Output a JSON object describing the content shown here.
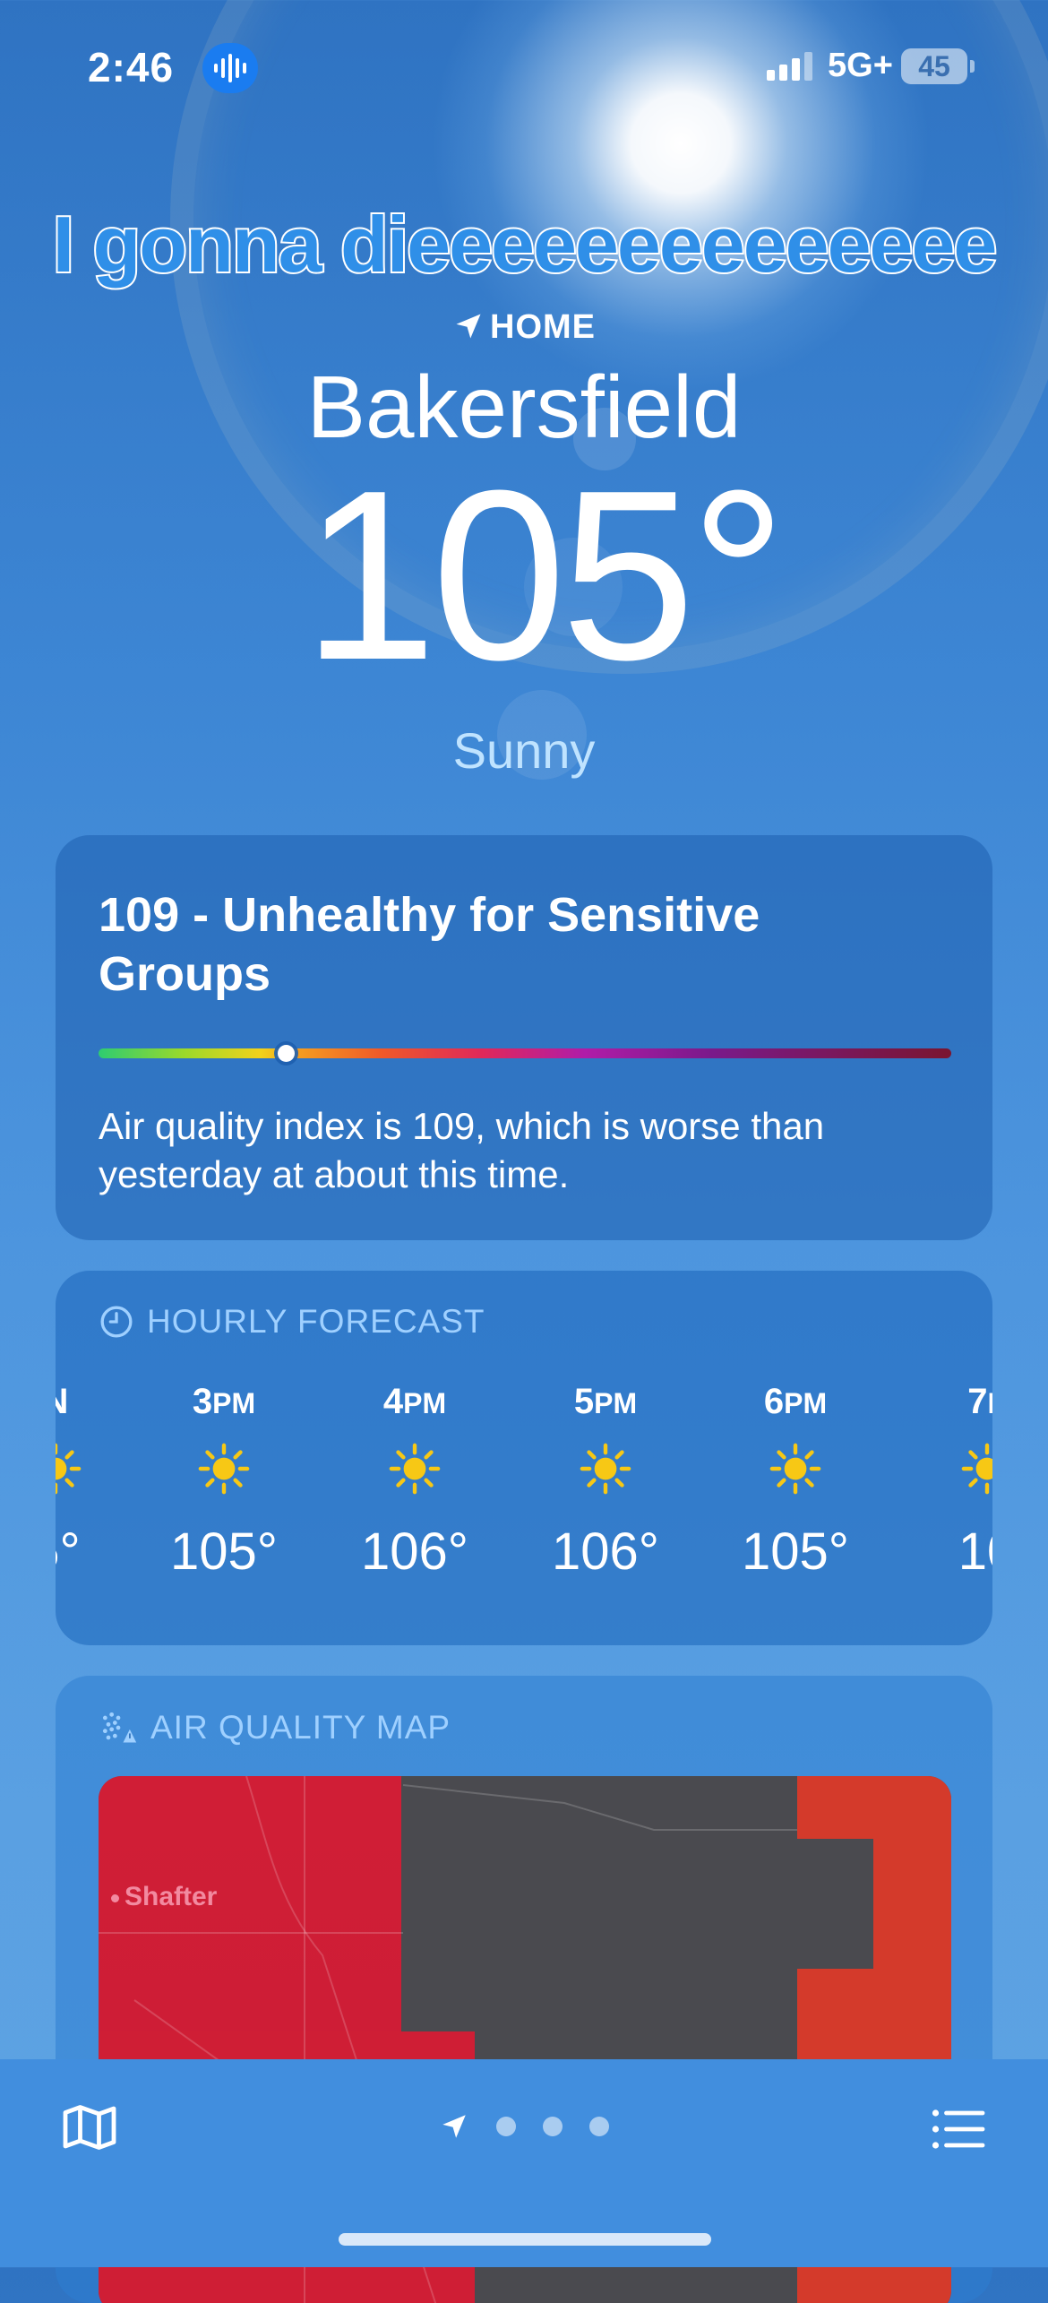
{
  "status_bar": {
    "time": "2:46",
    "network": "5G+",
    "battery": "45"
  },
  "caption": "I gonna dieeeeeeeeeeeeee",
  "location": {
    "label": "HOME",
    "city": "Bakersfield",
    "temperature": "105°",
    "condition": "Sunny"
  },
  "aqi": {
    "title": "109 - Unhealthy for Sensitive Groups",
    "value": 109,
    "scale_position_fraction": 0.22,
    "description": "Air quality index is 109, which is worse than yesterday at about this time."
  },
  "hourly": {
    "header": "HOURLY FORECAST",
    "hours": [
      {
        "hour": "N",
        "suffix": "",
        "temp": "5°",
        "icon": "sun-icon"
      },
      {
        "hour": "3",
        "suffix": "PM",
        "temp": "105°",
        "icon": "sun-icon"
      },
      {
        "hour": "4",
        "suffix": "PM",
        "temp": "106°",
        "icon": "sun-icon"
      },
      {
        "hour": "5",
        "suffix": "PM",
        "temp": "106°",
        "icon": "sun-icon"
      },
      {
        "hour": "6",
        "suffix": "PM",
        "temp": "105°",
        "icon": "sun-icon"
      },
      {
        "hour": "7",
        "suffix": "P",
        "temp": "10",
        "icon": "sun-icon"
      }
    ]
  },
  "air_quality_map": {
    "header": "AIR QUALITY MAP",
    "place_label": "Shafter"
  },
  "colors": {
    "sun_yellow": "#f7c815",
    "map_unhealthy_red": "#cf1e35",
    "map_neutral_gray": "#4a4a4f",
    "caption_blue": "#2f8fe8"
  }
}
